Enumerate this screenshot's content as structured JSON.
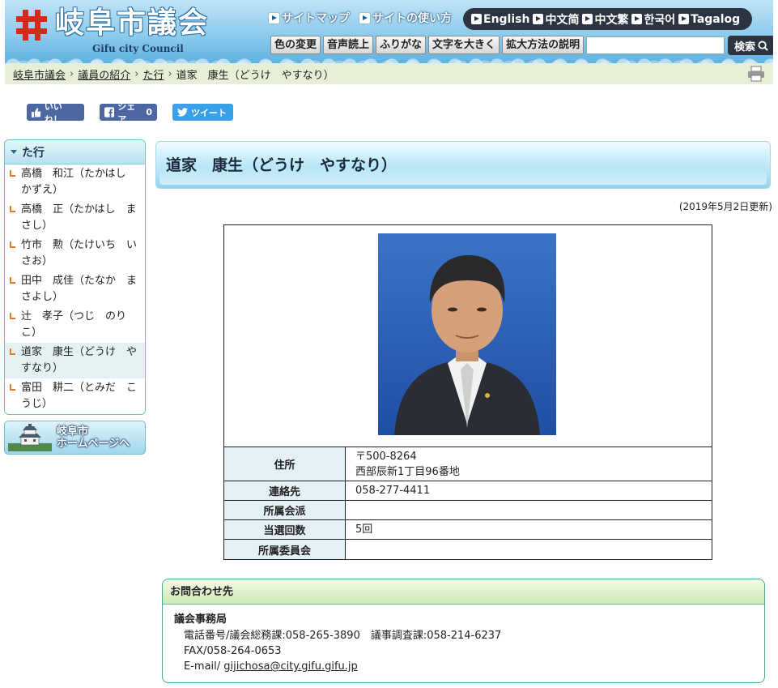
{
  "header": {
    "site_title": "岐阜市議会",
    "site_subtitle": "Gifu city Council",
    "top_links": [
      {
        "label": "サイトマップ"
      },
      {
        "label": "サイトの使い方"
      }
    ],
    "languages": [
      {
        "label": "English"
      },
      {
        "label": "中文简"
      },
      {
        "label": "中文繁"
      },
      {
        "label": "한국어"
      },
      {
        "label": "Tagalog"
      }
    ],
    "tool_buttons": [
      {
        "label": "色の変更"
      },
      {
        "label": "音声読上"
      },
      {
        "label": "ふりがな"
      },
      {
        "label": "文字を大きく"
      },
      {
        "label": "拡大方法の説明"
      }
    ],
    "search": {
      "placeholder": "",
      "value": "",
      "button_label": "検索"
    }
  },
  "breadcrumb": {
    "items": [
      "岐阜市議会",
      "議員の紹介",
      "た行"
    ],
    "current": "道家　康生（どうけ　やすなり）"
  },
  "social": {
    "like_label": "いいね！",
    "share_label": "シェア",
    "share_count": "0",
    "tweet_label": "ツイート"
  },
  "sidebar": {
    "heading": "た行",
    "items": [
      {
        "label": "高橋　和江（たかはし　かずえ）"
      },
      {
        "label": "高橋　正（たかはし　まさし）"
      },
      {
        "label": "竹市　勲（たけいち　いさお）"
      },
      {
        "label": "田中　成佳（たなか　まさよし）"
      },
      {
        "label": "辻　孝子（つじ　のりこ）"
      },
      {
        "label": "道家　康生（どうけ　やすなり）",
        "active": true
      },
      {
        "label": "富田　耕二（とみだ　こうじ）"
      }
    ],
    "home_banner": {
      "line1": "岐阜市",
      "line2": "ホームページへ"
    }
  },
  "main": {
    "title": "道家　康生（どうけ　やすなり）",
    "updated": "(2019年5月2日更新)",
    "profile": {
      "address_label": "住所",
      "address_line1": "〒500-8264",
      "address_line2": "西部辰新1丁目96番地",
      "contact_label": "連絡先",
      "contact_value": "058-277-4411",
      "faction_label": "所属会派",
      "faction_value": "",
      "elected_label": "当選回数",
      "elected_value": "5回",
      "committee_label": "所属委員会",
      "committee_value": ""
    }
  },
  "inquiry": {
    "heading": "お問合わせ先",
    "department": "議会事務局",
    "phone_line": "電話番号/議会総務課:058-265-3890　議事調査課:058-214-6237",
    "fax_line": "FAX/058-264-0653",
    "email_prefix": "E-mail/",
    "email": "gijichosa@city.gifu.gifu.jp"
  },
  "colors": {
    "header_blue": "#8ecbec",
    "lang_bar": "#2b3440",
    "breadcrumb_bg": "#e5f0d6",
    "sidebar_bullet": "#e07a2a",
    "table_header_bg": "#e3f1f7"
  }
}
